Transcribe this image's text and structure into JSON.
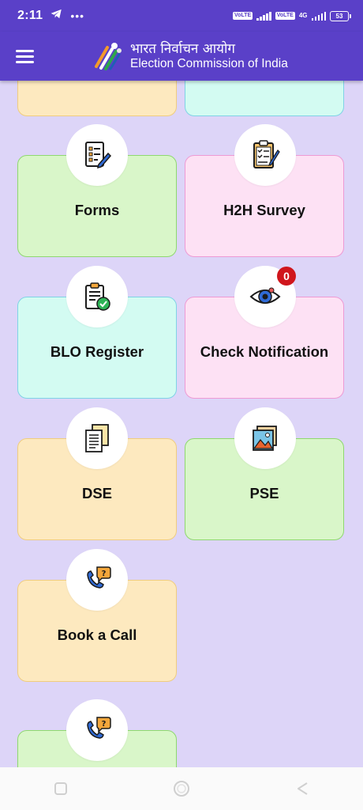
{
  "status_bar": {
    "time": "2:11",
    "sim1": "VoLTE",
    "sim2": "VoLTE",
    "network": "4G",
    "battery": "53"
  },
  "header": {
    "title_hindi": "भारत निर्वाचन आयोग",
    "title_english": "Election Commission of India"
  },
  "tiles": [
    {
      "label": "Forms",
      "icon": "form-icon",
      "color": "#d9f6c9"
    },
    {
      "label": "H2H Survey",
      "icon": "clipboard-checklist-icon",
      "color": "#fde1f4"
    },
    {
      "label": "BLO Register",
      "icon": "register-check-icon",
      "color": "#d3fbf2"
    },
    {
      "label": "Check Notification",
      "icon": "eye-icon",
      "color": "#fde1f4",
      "badge": "0"
    },
    {
      "label": "DSE",
      "icon": "documents-icon",
      "color": "#fde9bf"
    },
    {
      "label": "PSE",
      "icon": "photo-icon",
      "color": "#d9f6c9"
    },
    {
      "label": "Book a Call",
      "icon": "phone-help-icon",
      "color": "#fde9bf"
    }
  ],
  "colors": {
    "header": "#5a40c8",
    "background": "#ddd5f8",
    "badge": "#d0161c"
  }
}
